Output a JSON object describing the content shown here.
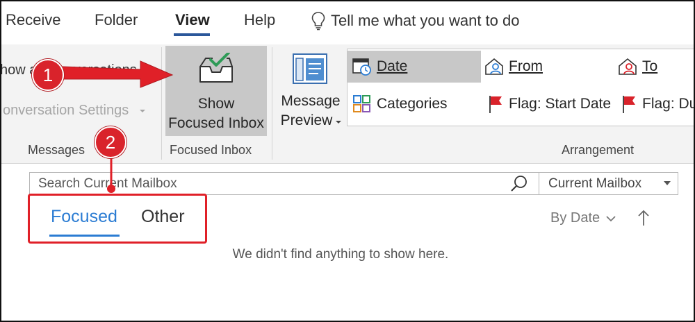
{
  "ribbon_tabs": [
    {
      "label": "Receive",
      "active": false
    },
    {
      "label": "Folder",
      "active": false
    },
    {
      "label": "View",
      "active": true
    },
    {
      "label": "Help",
      "active": false
    }
  ],
  "tell_me": {
    "label": "Tell me what you want to do"
  },
  "messages_group": {
    "show_as_conversations": "how as Conversations",
    "conversation_settings": "onversation Settings",
    "label": "Messages"
  },
  "focused_inbox_group": {
    "button_line1": "Show",
    "button_line2": "Focused Inbox",
    "label": "Focused Inbox"
  },
  "message_preview": {
    "line1": "Message",
    "line2": "Preview"
  },
  "arrangement": {
    "label": "Arrangement",
    "items": [
      {
        "label": "Date",
        "selected": true
      },
      {
        "label": "From",
        "selected": false
      },
      {
        "label": "To",
        "selected": false
      },
      {
        "label": "Categories",
        "selected": false
      },
      {
        "label": "Flag: Start Date",
        "selected": false
      },
      {
        "label": "Flag: Du",
        "selected": false
      }
    ]
  },
  "search": {
    "placeholder": "Search Current Mailbox",
    "scope": "Current Mailbox"
  },
  "inbox_tabs": [
    {
      "label": "Focused",
      "active": true
    },
    {
      "label": "Other",
      "active": false
    }
  ],
  "sort": {
    "label": "By Date"
  },
  "empty_message": "We didn't find anything to show here.",
  "annotations": {
    "step1": "1",
    "step2": "2"
  },
  "colors": {
    "accent_blue": "#2b7cd3",
    "annotation_red": "#e02028",
    "ribbon_bg": "#f3f3f3",
    "selected_bg": "#c8c8c8"
  }
}
